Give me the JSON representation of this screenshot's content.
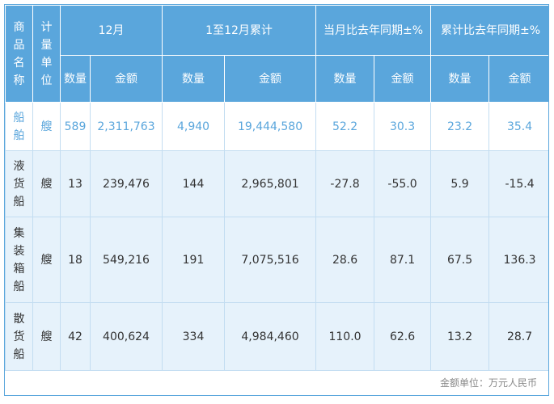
{
  "header": {
    "col_name": "商品名称",
    "col_unit": "计量单位",
    "group_month": "12月",
    "group_cumulative": "1至12月累计",
    "group_month_yoy": "当月比去年同期±%",
    "group_cumulative_yoy": "累计比去年同期±%",
    "sub_qty": "数量",
    "sub_amount": "金额"
  },
  "rows": [
    {
      "name": "船舶",
      "unit": "艘",
      "month_qty": "589",
      "month_amount": "2,311,763",
      "cum_qty": "4,940",
      "cum_amount": "19,444,580",
      "month_yoy_qty": "52.2",
      "month_yoy_amount": "30.3",
      "cum_yoy_qty": "23.2",
      "cum_yoy_amount": "35.4"
    },
    {
      "name": "液货船",
      "unit": "艘",
      "month_qty": "13",
      "month_amount": "239,476",
      "cum_qty": "144",
      "cum_amount": "2,965,801",
      "month_yoy_qty": "-27.8",
      "month_yoy_amount": "-55.0",
      "cum_yoy_qty": "5.9",
      "cum_yoy_amount": "-15.4"
    },
    {
      "name": "集装箱船",
      "unit": "艘",
      "month_qty": "18",
      "month_amount": "549,216",
      "cum_qty": "191",
      "cum_amount": "7,075,516",
      "month_yoy_qty": "28.6",
      "month_yoy_amount": "87.1",
      "cum_yoy_qty": "67.5",
      "cum_yoy_amount": "136.3"
    },
    {
      "name": "散货船",
      "unit": "艘",
      "month_qty": "42",
      "month_amount": "400,624",
      "cum_qty": "334",
      "cum_amount": "4,984,460",
      "month_yoy_qty": "110.0",
      "month_yoy_amount": "62.6",
      "cum_yoy_qty": "13.2",
      "cum_yoy_amount": "28.7"
    }
  ],
  "footer": {
    "note": "金额单位：万元人民币"
  }
}
